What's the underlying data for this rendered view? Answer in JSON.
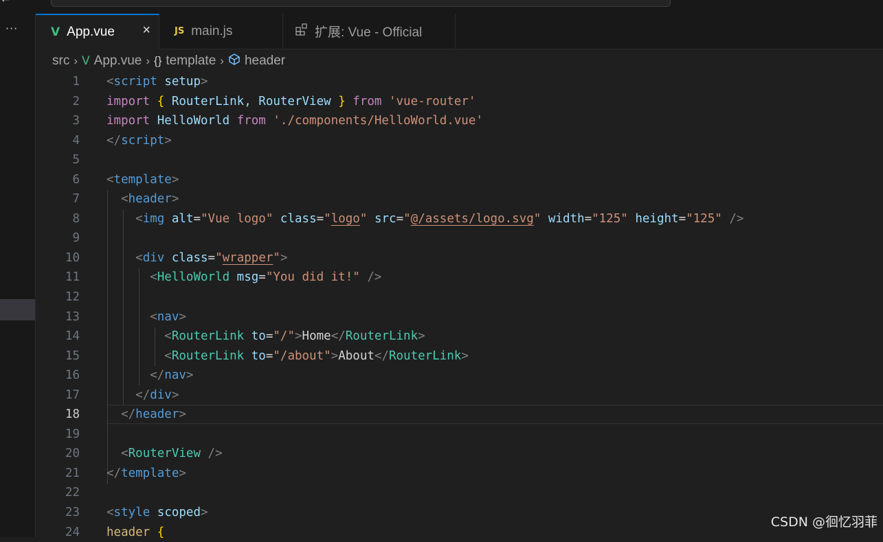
{
  "tabs": [
    {
      "label": "App.vue",
      "icon": "vue-icon",
      "active": true,
      "close": "×"
    },
    {
      "label": "main.js",
      "icon": "js-icon",
      "icon_text": "JS",
      "active": false
    },
    {
      "label": "扩展: Vue - Official",
      "icon": "extension-icon",
      "active": false
    }
  ],
  "breadcrumb": {
    "items": [
      "src",
      "App.vue",
      "template",
      "header"
    ],
    "icons": [
      "",
      "vue-icon",
      "braces-icon",
      "element-icon"
    ],
    "braces_glyph": "{}"
  },
  "sidebar": {
    "more": "···"
  },
  "editor": {
    "current_line": 18,
    "line_numbers": [
      "1",
      "2",
      "3",
      "4",
      "5",
      "6",
      "7",
      "8",
      "9",
      "10",
      "11",
      "12",
      "13",
      "14",
      "15",
      "16",
      "17",
      "18",
      "19",
      "20",
      "21",
      "22",
      "23",
      "24"
    ],
    "lines": [
      [
        [
          "<",
          "punc"
        ],
        [
          "script",
          "tag"
        ],
        [
          " ",
          "text"
        ],
        [
          "setup",
          "attr"
        ],
        [
          ">",
          "punc"
        ]
      ],
      [
        [
          "import",
          "kw"
        ],
        [
          " ",
          "text"
        ],
        [
          "{",
          "brace"
        ],
        [
          " RouterLink, RouterView ",
          "attr"
        ],
        [
          "}",
          "brace"
        ],
        [
          " ",
          "text"
        ],
        [
          "from",
          "kw"
        ],
        [
          " ",
          "text"
        ],
        [
          "'vue-router'",
          "str"
        ]
      ],
      [
        [
          "import",
          "kw"
        ],
        [
          " ",
          "text"
        ],
        [
          "HelloWorld",
          "attr"
        ],
        [
          " ",
          "text"
        ],
        [
          "from",
          "kw"
        ],
        [
          " ",
          "text"
        ],
        [
          "'./components/HelloWorld.vue'",
          "str"
        ]
      ],
      [
        [
          "</",
          "punc"
        ],
        [
          "script",
          "tag"
        ],
        [
          ">",
          "punc"
        ]
      ],
      [],
      [
        [
          "<",
          "punc"
        ],
        [
          "template",
          "tag"
        ],
        [
          ">",
          "punc"
        ]
      ],
      [
        [
          "  ",
          "text"
        ],
        [
          "<",
          "punc"
        ],
        [
          "header",
          "tag"
        ],
        [
          ">",
          "punc"
        ]
      ],
      [
        [
          "    ",
          "text"
        ],
        [
          "<",
          "punc"
        ],
        [
          "img",
          "tag"
        ],
        [
          " ",
          "text"
        ],
        [
          "alt",
          "attr"
        ],
        [
          "=",
          "text"
        ],
        [
          "\"Vue logo\"",
          "str"
        ],
        [
          " ",
          "text"
        ],
        [
          "class",
          "attr"
        ],
        [
          "=",
          "text"
        ],
        [
          "\"",
          "str"
        ],
        [
          "logo",
          "strU"
        ],
        [
          "\"",
          "str"
        ],
        [
          " ",
          "text"
        ],
        [
          "src",
          "attr"
        ],
        [
          "=",
          "text"
        ],
        [
          "\"",
          "str"
        ],
        [
          "@/assets/logo.svg",
          "strU"
        ],
        [
          "\"",
          "str"
        ],
        [
          " ",
          "text"
        ],
        [
          "width",
          "attr"
        ],
        [
          "=",
          "text"
        ],
        [
          "\"125\"",
          "str"
        ],
        [
          " ",
          "text"
        ],
        [
          "height",
          "attr"
        ],
        [
          "=",
          "text"
        ],
        [
          "\"125\"",
          "str"
        ],
        [
          " ",
          "text"
        ],
        [
          "/>",
          "punc"
        ]
      ],
      [],
      [
        [
          "    ",
          "text"
        ],
        [
          "<",
          "punc"
        ],
        [
          "div",
          "tag"
        ],
        [
          " ",
          "text"
        ],
        [
          "class",
          "attr"
        ],
        [
          "=",
          "text"
        ],
        [
          "\"",
          "str"
        ],
        [
          "wrapper",
          "strU"
        ],
        [
          "\"",
          "str"
        ],
        [
          ">",
          "punc"
        ]
      ],
      [
        [
          "      ",
          "text"
        ],
        [
          "<",
          "punc"
        ],
        [
          "HelloWorld",
          "comp"
        ],
        [
          " ",
          "text"
        ],
        [
          "msg",
          "attr"
        ],
        [
          "=",
          "text"
        ],
        [
          "\"You did it!\"",
          "str"
        ],
        [
          " ",
          "text"
        ],
        [
          "/>",
          "punc"
        ]
      ],
      [],
      [
        [
          "      ",
          "text"
        ],
        [
          "<",
          "punc"
        ],
        [
          "nav",
          "tag"
        ],
        [
          ">",
          "punc"
        ]
      ],
      [
        [
          "        ",
          "text"
        ],
        [
          "<",
          "punc"
        ],
        [
          "RouterLink",
          "comp"
        ],
        [
          " ",
          "text"
        ],
        [
          "to",
          "attr"
        ],
        [
          "=",
          "text"
        ],
        [
          "\"/\"",
          "str"
        ],
        [
          ">",
          "punc"
        ],
        [
          "Home",
          "text"
        ],
        [
          "</",
          "punc"
        ],
        [
          "RouterLink",
          "comp"
        ],
        [
          ">",
          "punc"
        ]
      ],
      [
        [
          "        ",
          "text"
        ],
        [
          "<",
          "punc"
        ],
        [
          "RouterLink",
          "comp"
        ],
        [
          " ",
          "text"
        ],
        [
          "to",
          "attr"
        ],
        [
          "=",
          "text"
        ],
        [
          "\"/about\"",
          "str"
        ],
        [
          ">",
          "punc"
        ],
        [
          "About",
          "text"
        ],
        [
          "</",
          "punc"
        ],
        [
          "RouterLink",
          "comp"
        ],
        [
          ">",
          "punc"
        ]
      ],
      [
        [
          "      ",
          "text"
        ],
        [
          "</",
          "punc"
        ],
        [
          "nav",
          "tag"
        ],
        [
          ">",
          "punc"
        ]
      ],
      [
        [
          "    ",
          "text"
        ],
        [
          "</",
          "punc"
        ],
        [
          "div",
          "tag"
        ],
        [
          ">",
          "punc"
        ]
      ],
      [
        [
          "  ",
          "text"
        ],
        [
          "</",
          "punc"
        ],
        [
          "header",
          "tag"
        ],
        [
          ">",
          "punc"
        ]
      ],
      [],
      [
        [
          "  ",
          "text"
        ],
        [
          "<",
          "punc"
        ],
        [
          "RouterView",
          "comp"
        ],
        [
          " ",
          "text"
        ],
        [
          "/>",
          "punc"
        ]
      ],
      [
        [
          "</",
          "punc"
        ],
        [
          "template",
          "tag"
        ],
        [
          ">",
          "punc"
        ]
      ],
      [],
      [
        [
          "<",
          "punc"
        ],
        [
          "style",
          "tag"
        ],
        [
          " ",
          "text"
        ],
        [
          "scoped",
          "attr"
        ],
        [
          ">",
          "punc"
        ]
      ],
      [
        [
          "header",
          "sel"
        ],
        [
          " ",
          "text"
        ],
        [
          "{",
          "brace"
        ]
      ]
    ]
  },
  "watermark": "CSDN @徊忆羽菲",
  "colors": {
    "background": "#1f1f1f",
    "accent": "#0078d4",
    "tag": "#569cd6",
    "component": "#4ec9b0",
    "attribute": "#9cdcfe",
    "string": "#ce9178",
    "keyword": "#c586c0"
  }
}
